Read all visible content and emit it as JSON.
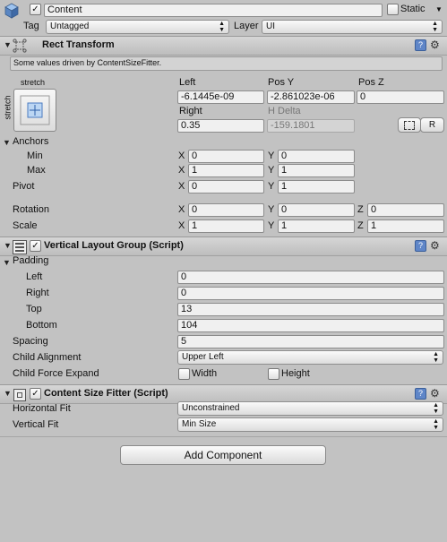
{
  "gameobject": {
    "name": "Content",
    "static_label": "Static",
    "tag_label": "Tag",
    "tag_value": "Untagged",
    "layer_label": "Layer",
    "layer_value": "UI"
  },
  "rect_transform": {
    "title": "Rect Transform",
    "driven_note": "Some values driven by ContentSizeFitter.",
    "anchor_preset_top": "stretch",
    "anchor_preset_side": "stretch",
    "left_label": "Left",
    "left_value": "-6.1445e-09",
    "posy_label": "Pos Y",
    "posy_value": "-2.861023e-06",
    "posz_label": "Pos Z",
    "posz_value": "0",
    "right_label": "Right",
    "right_value": "0.35",
    "hdelta_label": "H Delta",
    "hdelta_value": "-159.1801",
    "r_button": "R",
    "anchors_label": "Anchors",
    "min_label": "Min",
    "min_x": "0",
    "min_y": "0",
    "max_label": "Max",
    "max_x": "1",
    "max_y": "1",
    "pivot_label": "Pivot",
    "pivot_x": "0",
    "pivot_y": "1",
    "rotation_label": "Rotation",
    "rot_x": "0",
    "rot_y": "0",
    "rot_z": "0",
    "scale_label": "Scale",
    "scale_x": "1",
    "scale_y": "1",
    "scale_z": "1",
    "x": "X",
    "y": "Y",
    "z": "Z"
  },
  "vertical_layout": {
    "title": "Vertical Layout Group (Script)",
    "padding_label": "Padding",
    "left_label": "Left",
    "left_value": "0",
    "right_label": "Right",
    "right_value": "0",
    "top_label": "Top",
    "top_value": "13",
    "bottom_label": "Bottom",
    "bottom_value": "104",
    "spacing_label": "Spacing",
    "spacing_value": "5",
    "child_alignment_label": "Child Alignment",
    "child_alignment_value": "Upper Left",
    "child_force_label": "Child Force Expand",
    "width_label": "Width",
    "height_label": "Height"
  },
  "content_size_fitter": {
    "title": "Content Size Fitter (Script)",
    "horizontal_label": "Horizontal Fit",
    "horizontal_value": "Unconstrained",
    "vertical_label": "Vertical Fit",
    "vertical_value": "Min Size"
  },
  "add_component": "Add Component"
}
